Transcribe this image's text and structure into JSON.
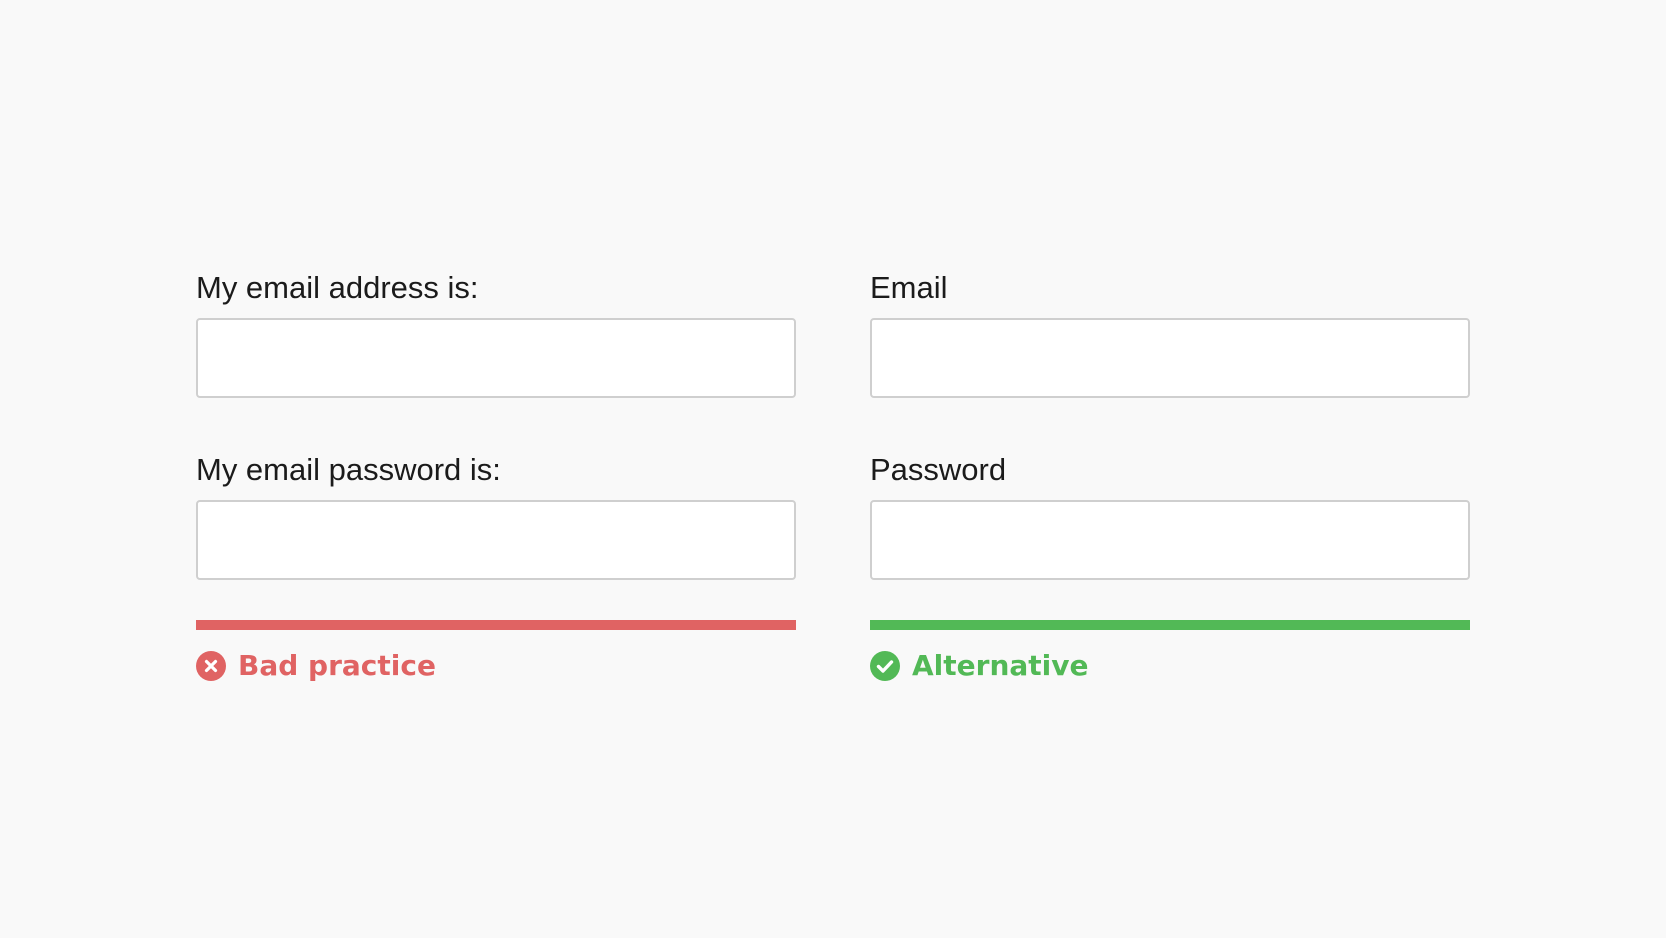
{
  "bad": {
    "email_label": "My email address is:",
    "email_value": "",
    "email_placeholder": "",
    "password_label": "My email password is:",
    "password_value": "",
    "password_placeholder": "",
    "verdict": "Bad practice",
    "icon": "error-x-icon",
    "color": "#e06363"
  },
  "good": {
    "email_label": "Email",
    "email_value": "",
    "email_placeholder": "",
    "password_label": "Password",
    "password_value": "",
    "password_placeholder": "",
    "verdict": "Alternative",
    "icon": "check-icon",
    "color": "#52b956"
  }
}
